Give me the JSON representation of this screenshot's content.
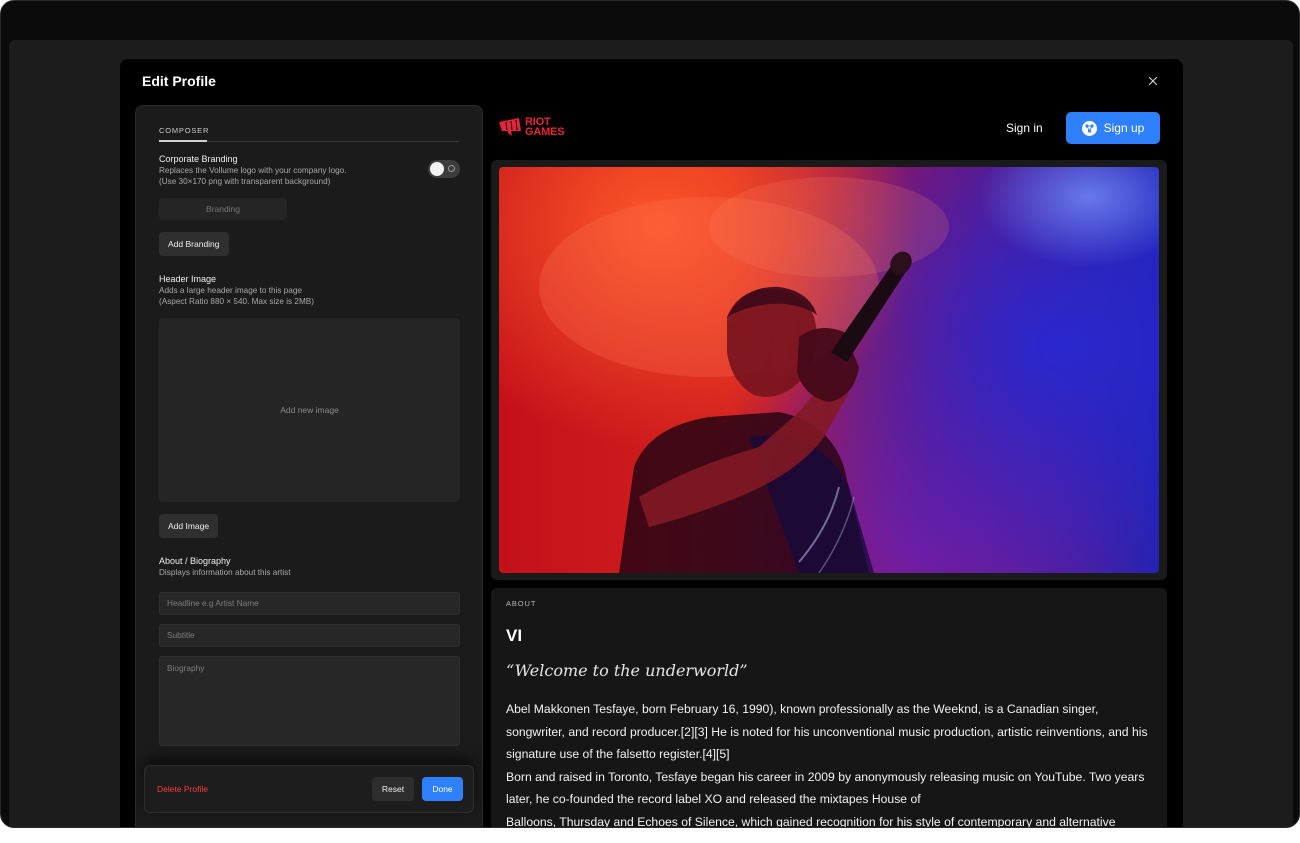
{
  "modal": {
    "title": "Edit Profile"
  },
  "composer": {
    "tab_label": "COMPOSER",
    "branding": {
      "title": "Corporate Branding",
      "desc_line1": "Replaces the Vollume logo with your company logo.",
      "desc_line2": "(Use 30×170 png with transparent background)",
      "field_placeholder": "Branding",
      "add_button": "Add Branding",
      "toggle_on": false
    },
    "header_image": {
      "title": "Header Image",
      "desc_line1": "Adds a large header image to this page",
      "desc_line2": "(Aspect Ratio 880 × 540. Max size is 2MB)",
      "drop_label": "Add new image",
      "add_button": "Add Image"
    },
    "about": {
      "title": "About / Biography",
      "desc": "Displays information about this artist",
      "headline_placeholder": "Headline e.g Artist Name",
      "subtitle_placeholder": "Subtitle",
      "biography_placeholder": "Biography"
    },
    "actions": {
      "delete": "Delete Profile",
      "reset": "Reset",
      "done": "Done"
    }
  },
  "preview": {
    "logo_line1": "RIOT",
    "logo_line2": "GAMES",
    "signin": "Sign in",
    "signup": "Sign up",
    "about_label": "ABOUT",
    "artist_name": "VI",
    "quote": "“Welcome to the underworld”",
    "bio_p1": "Abel Makkonen Tesfaye, born February 16, 1990), known professionally as the Weeknd, is a Canadian singer, songwriter, and record producer.[2][3] He is noted for his unconventional music production, artistic reinventions, and his signature use of the falsetto register.[4][5]",
    "bio_p2": "Born and raised in Toronto, Tesfaye began his career in 2009 by anonymously releasing music on YouTube. Two years later, he co-founded the record label XO and released the mixtapes House of",
    "bio_p3": "Balloons, Thursday and Echoes of Silence, which gained recognition for his style of contemporary and alternative"
  },
  "colors": {
    "accent": "#2f80ff",
    "danger": "#ff3b3b",
    "brand": "#e8233b"
  }
}
